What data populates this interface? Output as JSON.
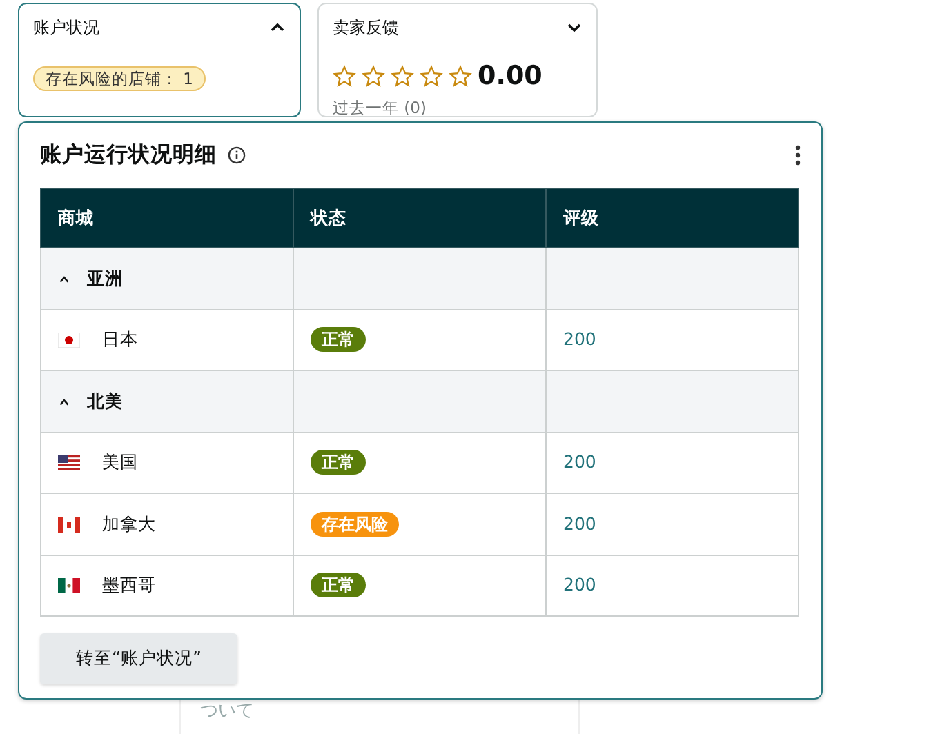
{
  "account_status": {
    "title": "账户状况",
    "expanded": true,
    "badge": "存在风险的店铺： 1"
  },
  "seller_feedback": {
    "title": "卖家反馈",
    "expanded": false,
    "stars": 0,
    "score": "0.00",
    "period": "过去一年 (0)"
  },
  "panel": {
    "title": "账户运行状况明细",
    "columns": [
      "商城",
      "状态",
      "评级"
    ],
    "groups": [
      {
        "name": "亚洲",
        "expanded": true,
        "rows": [
          {
            "kind": "jp",
            "name": "日本",
            "status": {
              "kind": "ok",
              "label": "正常"
            },
            "rating": "200"
          }
        ]
      },
      {
        "name": "北美",
        "expanded": true,
        "rows": [
          {
            "kind": "us",
            "name": "美国",
            "status": {
              "kind": "ok",
              "label": "正常"
            },
            "rating": "200"
          },
          {
            "kind": "ca",
            "name": "加拿大",
            "status": {
              "kind": "risk",
              "label": "存在风险"
            },
            "rating": "200"
          },
          {
            "kind": "mx",
            "name": "墨西哥",
            "status": {
              "kind": "ok",
              "label": "正常"
            },
            "rating": "200"
          }
        ]
      }
    ],
    "button": "转至“账户状况”"
  },
  "background_text": "ついて"
}
